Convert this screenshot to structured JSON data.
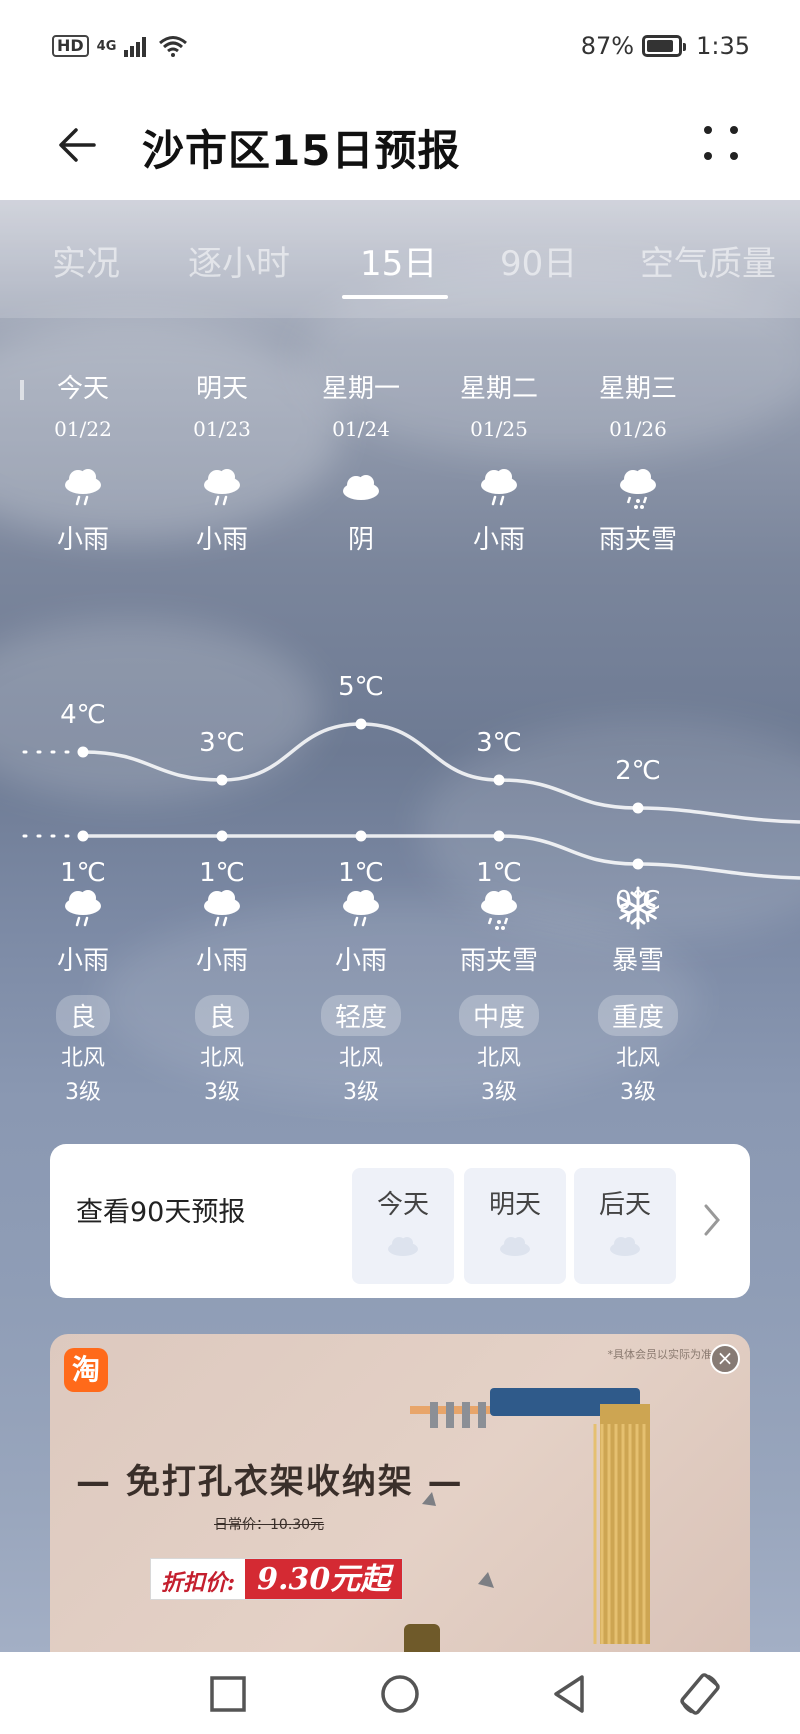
{
  "status_bar": {
    "hd": "HD",
    "network": "4G",
    "battery_percent": "87%",
    "battery_level": 0.87,
    "time": "1:35"
  },
  "header": {
    "title": "沙市区15日预报",
    "back_icon": "arrow-left-icon",
    "more_icon": "more-dots-icon"
  },
  "tabs": [
    {
      "label": "实况",
      "active": false
    },
    {
      "label": "逐小时",
      "active": false
    },
    {
      "label": "15日",
      "active": true
    },
    {
      "label": "90日",
      "active": false
    },
    {
      "label": "空气质量",
      "active": false
    }
  ],
  "forecast": {
    "days": [
      {
        "name": "今天",
        "date": "01/22",
        "day_weather": "小雨",
        "day_icon": "light-rain-icon",
        "high": 4,
        "high_label": "4℃",
        "low": 1,
        "low_label": "1℃",
        "night_weather": "小雨",
        "night_icon": "light-rain-icon",
        "aqi": "良",
        "wind_dir": "北风",
        "wind_level": "3级"
      },
      {
        "name": "明天",
        "date": "01/23",
        "day_weather": "小雨",
        "day_icon": "light-rain-icon",
        "high": 3,
        "high_label": "3℃",
        "low": 1,
        "low_label": "1℃",
        "night_weather": "小雨",
        "night_icon": "light-rain-icon",
        "aqi": "良",
        "wind_dir": "北风",
        "wind_level": "3级"
      },
      {
        "name": "星期一",
        "date": "01/24",
        "day_weather": "阴",
        "day_icon": "overcast-icon",
        "high": 5,
        "high_label": "5℃",
        "low": 1,
        "low_label": "1℃",
        "night_weather": "小雨",
        "night_icon": "light-rain-icon",
        "aqi": "轻度",
        "wind_dir": "北风",
        "wind_level": "3级"
      },
      {
        "name": "星期二",
        "date": "01/25",
        "day_weather": "小雨",
        "day_icon": "light-rain-icon",
        "high": 3,
        "high_label": "3℃",
        "low": 1,
        "low_label": "1℃",
        "night_weather": "雨夹雪",
        "night_icon": "sleet-icon",
        "aqi": "中度",
        "wind_dir": "北风",
        "wind_level": "3级"
      },
      {
        "name": "星期三",
        "date": "01/26",
        "day_weather": "雨夹雪",
        "day_icon": "sleet-icon",
        "high": 2,
        "high_label": "2℃",
        "low": 0,
        "low_label": "0℃",
        "night_weather": "暴雪",
        "night_icon": "snowflake-icon",
        "aqi": "重度",
        "wind_dir": "北风",
        "wind_level": "3级"
      }
    ]
  },
  "card90": {
    "title": "查看90天预报",
    "days": [
      {
        "label": "今天"
      },
      {
        "label": "明天"
      },
      {
        "label": "后天"
      }
    ]
  },
  "ad": {
    "logo": "淘",
    "note": "*具体会员以实际为准",
    "headline": "— 免打孔衣架收纳架 —",
    "original_price": "日常价：10.30元",
    "price_label": "折扣价:",
    "price_value": "9.30元起",
    "close": "×"
  },
  "colors": {
    "accent_white": "#ffffff",
    "ad_price_red": "#d42a33",
    "taobao_orange": "#ff6a1a"
  }
}
